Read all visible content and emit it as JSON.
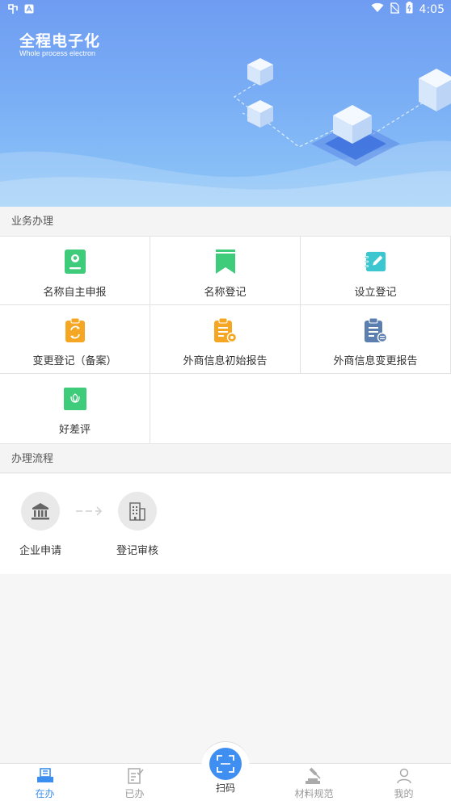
{
  "status_bar": {
    "time": "4:05"
  },
  "banner": {
    "title": "全程电子化",
    "subtitle": "Whole process electron"
  },
  "section_business": "业务办理",
  "services": [
    {
      "label": "名称自主申报",
      "icon": "profile-card-icon"
    },
    {
      "label": "名称登记",
      "icon": "bookmark-icon"
    },
    {
      "label": "设立登记",
      "icon": "edit-note-icon"
    },
    {
      "label": "变更登记（备案）",
      "icon": "refresh-clipboard-icon"
    },
    {
      "label": "外商信息初始报告",
      "icon": "report-clipboard-icon"
    },
    {
      "label": "外商信息变更报告",
      "icon": "exchange-clipboard-icon"
    },
    {
      "label": "好差评",
      "icon": "flower-rating-icon"
    }
  ],
  "section_process": "办理流程",
  "process_steps": [
    {
      "label": "企业申请",
      "icon": "bank-building-icon"
    },
    {
      "label": "登记审核",
      "icon": "office-building-icon"
    }
  ],
  "bottom_nav": {
    "tab1": "在办",
    "tab2": "已办",
    "scan": "扫码",
    "tab4": "材料规范",
    "tab5": "我的"
  },
  "colors": {
    "accent": "#3c8df0",
    "green": "#3ecb7a",
    "teal": "#3cc6cf",
    "orange": "#f5a623",
    "steel_blue": "#5b7fae"
  }
}
